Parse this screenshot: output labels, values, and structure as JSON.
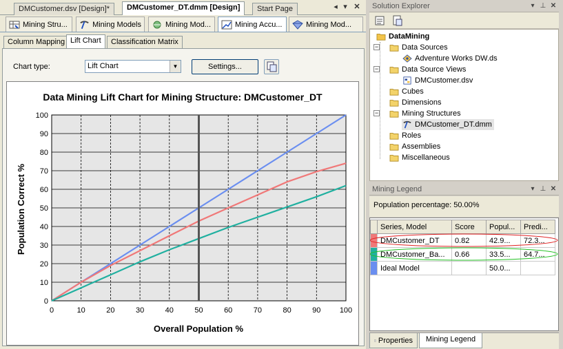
{
  "doc_tabs": [
    {
      "label": "DMCustomer.dsv [Design]*"
    },
    {
      "label": "DMCustomer_DT.dmm [Design]"
    },
    {
      "label": "Start Page"
    }
  ],
  "designer_tabs": [
    {
      "label": "Mining Stru..."
    },
    {
      "label": "Mining Models"
    },
    {
      "label": "Mining Mod..."
    },
    {
      "label": "Mining Accu..."
    },
    {
      "label": "Mining Mod..."
    }
  ],
  "sub_tabs": [
    {
      "label": "Column Mapping"
    },
    {
      "label": "Lift Chart"
    },
    {
      "label": "Classification Matrix"
    }
  ],
  "controls": {
    "chart_type_label": "Chart type:",
    "chart_type_value": "Lift Chart",
    "settings_button": "Settings..."
  },
  "chart_data": {
    "type": "line",
    "title": "Data Mining Lift Chart for Mining Structure: DMCustomer_DT",
    "xlabel": "Overall Population %",
    "ylabel": "Population Correct %",
    "xlim": [
      0,
      100
    ],
    "ylim": [
      0,
      100
    ],
    "x_ticks": [
      "0",
      "10",
      "20",
      "30",
      "40",
      "50",
      "60",
      "70",
      "80",
      "90",
      "100"
    ],
    "y_ticks": [
      "0",
      "10",
      "20",
      "30",
      "40",
      "50",
      "60",
      "70",
      "80",
      "90",
      "100"
    ],
    "grid": true,
    "marker_x": 50,
    "series": [
      {
        "color": "#6a8ef0",
        "x": [
          0,
          10,
          20,
          30,
          40,
          50,
          60,
          70,
          80,
          90,
          100
        ],
        "y": [
          0,
          10,
          20,
          30,
          40,
          50,
          60,
          70,
          80,
          90,
          100
        ]
      },
      {
        "color": "#f07878",
        "x": [
          0,
          10,
          20,
          30,
          40,
          50,
          60,
          70,
          80,
          90,
          100
        ],
        "y": [
          0,
          10,
          19,
          27,
          35,
          42.9,
          50,
          57,
          64,
          69.5,
          74
        ]
      },
      {
        "color": "#20b0a0",
        "x": [
          0,
          10,
          20,
          30,
          40,
          50,
          60,
          70,
          80,
          90,
          100
        ],
        "y": [
          0,
          7,
          14,
          21,
          27.5,
          33.5,
          39.5,
          45,
          50.5,
          56,
          62
        ]
      }
    ]
  },
  "solution_explorer": {
    "title": "Solution Explorer",
    "items": [
      {
        "label": "DataMining",
        "bold": true
      },
      {
        "label": "Data Sources"
      },
      {
        "label": "Adventure Works DW.ds"
      },
      {
        "label": "Data Source Views"
      },
      {
        "label": "DMCustomer.dsv"
      },
      {
        "label": "Cubes"
      },
      {
        "label": "Dimensions"
      },
      {
        "label": "Mining Structures"
      },
      {
        "label": "DMCustomer_DT.dmm"
      },
      {
        "label": "Roles"
      },
      {
        "label": "Assemblies"
      },
      {
        "label": "Miscellaneous"
      }
    ]
  },
  "mining_legend": {
    "title": "Mining Legend",
    "population_text": "Population percentage: 50.00%",
    "headers": [
      "Series, Model",
      "Score",
      "Popul...",
      "Predi..."
    ],
    "rows": [
      {
        "color": "#f07878",
        "model": "DMCustomer_DT",
        "score": "0.82",
        "population": "42.9...",
        "predict": "72.3..."
      },
      {
        "color": "#20b0a0",
        "model": "DMCustomer_Ba...",
        "score": "0.66",
        "population": "33.5...",
        "predict": "64.7..."
      },
      {
        "color": "#6a8ef0",
        "model": "Ideal Model",
        "score": "",
        "population": "50.0...",
        "predict": ""
      }
    ]
  },
  "bottom_tabs": [
    {
      "label": "Properties"
    },
    {
      "label": "Mining Legend"
    }
  ]
}
